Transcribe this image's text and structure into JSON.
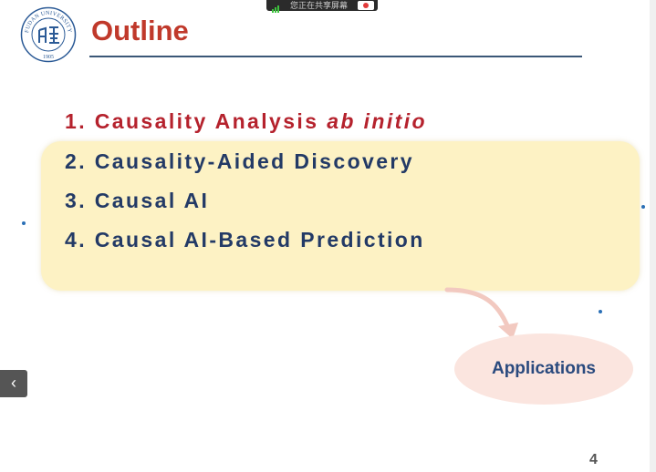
{
  "share_bar": {
    "text": "您正在共享屏幕"
  },
  "logo": {
    "name": "FUDAN UNIVERSITY",
    "year": "1905",
    "colors": {
      "ring": "#2b5a96"
    }
  },
  "slide": {
    "title": "Outline",
    "items": [
      {
        "number": "1.",
        "text": "Causality Analysis ",
        "emphasis": "ab initio",
        "active": true
      },
      {
        "number": "2.",
        "text": "Causality-Aided Discovery",
        "active": false
      },
      {
        "number": "3.",
        "text": "Causal AI",
        "active": false
      },
      {
        "number": "4.",
        "text": "Causal AI-Based Prediction",
        "active": false
      }
    ],
    "callout": "Applications",
    "page_number": "4"
  },
  "colors": {
    "title": "#c0392b",
    "active_item": "#b5222d",
    "item": "#233a66",
    "highlight": "#fdf2c4",
    "callout": "#fbe5df"
  },
  "nav": {
    "prev_icon": "chevron-left-icon"
  }
}
